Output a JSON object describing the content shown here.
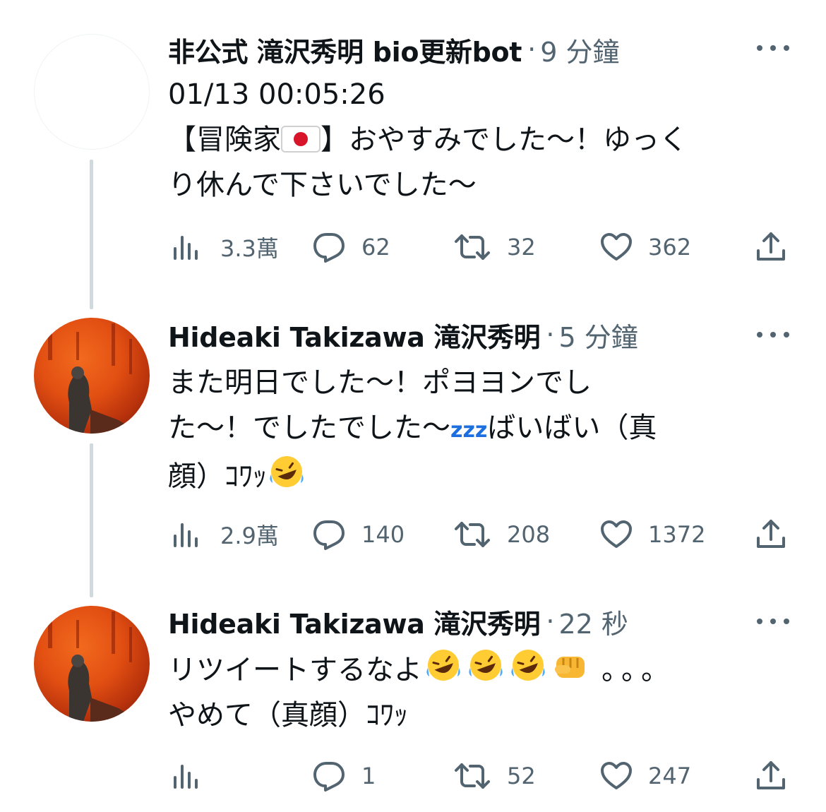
{
  "tweets": [
    {
      "name": "非公式 滝沢秀明 bio更新bot",
      "time": "9 分鐘",
      "text_lines": [
        "01/13 00:05:26",
        "【冒険家",
        "】おやすみでした〜！ゆっく",
        "り休んで下さいでした〜"
      ],
      "views": "3.3萬",
      "replies": "62",
      "retweets": "32",
      "likes": "362"
    },
    {
      "name": "Hideaki Takizawa 滝沢秀明",
      "time": "5 分鐘",
      "text_lines": [
        "また明日でした〜！ポヨヨンでし",
        "た〜！でしたでした〜",
        "ばいばい（真",
        "顔）ｺﾜｯ"
      ],
      "zz": "zzz",
      "views": "2.9萬",
      "replies": "140",
      "retweets": "208",
      "likes": "1372"
    },
    {
      "name": "Hideaki Takizawa 滝沢秀明",
      "time": "22 秒",
      "text_lines": [
        "リツイートするなよ",
        "。。。",
        "やめて（真顔）ｺﾜｯ"
      ],
      "replies": "1",
      "retweets": "52",
      "likes": "247"
    }
  ],
  "icons": [
    "more-icon",
    "views-icon",
    "reply-icon",
    "retweet-icon",
    "like-icon",
    "share-icon",
    "japan-flag-icon",
    "rofl-emoji-icon",
    "fist-emoji-icon"
  ],
  "colors": {
    "text": "#0f1419",
    "secondary": "#536471",
    "thread_line": "#cfd9de",
    "zz": "#1d6fe0"
  }
}
